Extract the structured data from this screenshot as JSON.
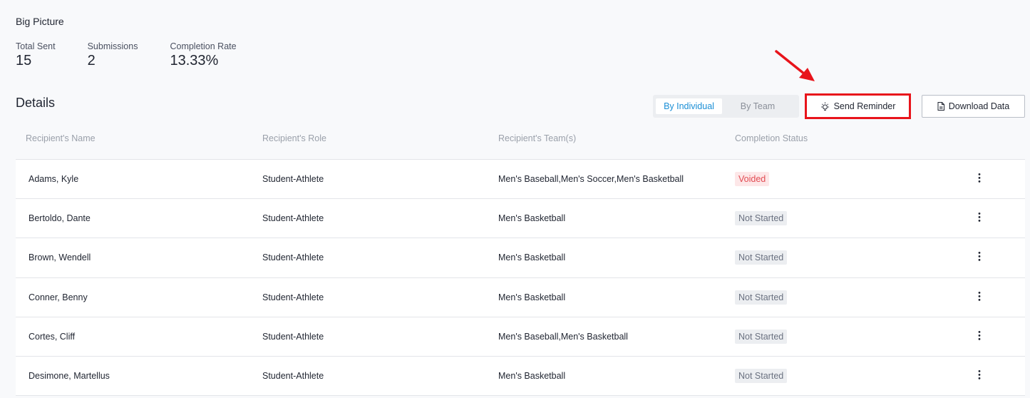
{
  "overview": {
    "title": "Big Picture",
    "stats": [
      {
        "label": "Total Sent",
        "value": "15"
      },
      {
        "label": "Submissions",
        "value": "2"
      },
      {
        "label": "Completion Rate",
        "value": "13.33%"
      }
    ]
  },
  "details": {
    "title": "Details",
    "view_toggle": {
      "individual": "By Individual",
      "team": "By Team",
      "selected": "By Individual"
    },
    "send_reminder_label": "Send Reminder",
    "download_label": "Download Data",
    "annotation_color": "#e8141b"
  },
  "table": {
    "columns": [
      "Recipient's Name",
      "Recipient's Role",
      "Recipient's Team(s)",
      "Completion Status"
    ],
    "rows": [
      {
        "name": "Adams, Kyle",
        "role": "Student-Athlete",
        "teams": "Men's Baseball,Men's Soccer,Men's Basketball",
        "status": "Voided"
      },
      {
        "name": "Bertoldo, Dante",
        "role": "Student-Athlete",
        "teams": "Men's Basketball",
        "status": "Not Started"
      },
      {
        "name": "Brown, Wendell",
        "role": "Student-Athlete",
        "teams": "Men's Basketball",
        "status": "Not Started"
      },
      {
        "name": "Conner, Benny",
        "role": "Student-Athlete",
        "teams": "Men's Basketball",
        "status": "Not Started"
      },
      {
        "name": "Cortes, Cliff",
        "role": "Student-Athlete",
        "teams": "Men's Baseball,Men's Basketball",
        "status": "Not Started"
      },
      {
        "name": "Desimone, Martellus",
        "role": "Student-Athlete",
        "teams": "Men's Basketball",
        "status": "Not Started"
      }
    ]
  },
  "colors": {
    "accent": "#1b8fd6",
    "voided_text": "#e24b52",
    "voided_bg": "#fde7e8",
    "not_started_bg": "#eceef1"
  }
}
